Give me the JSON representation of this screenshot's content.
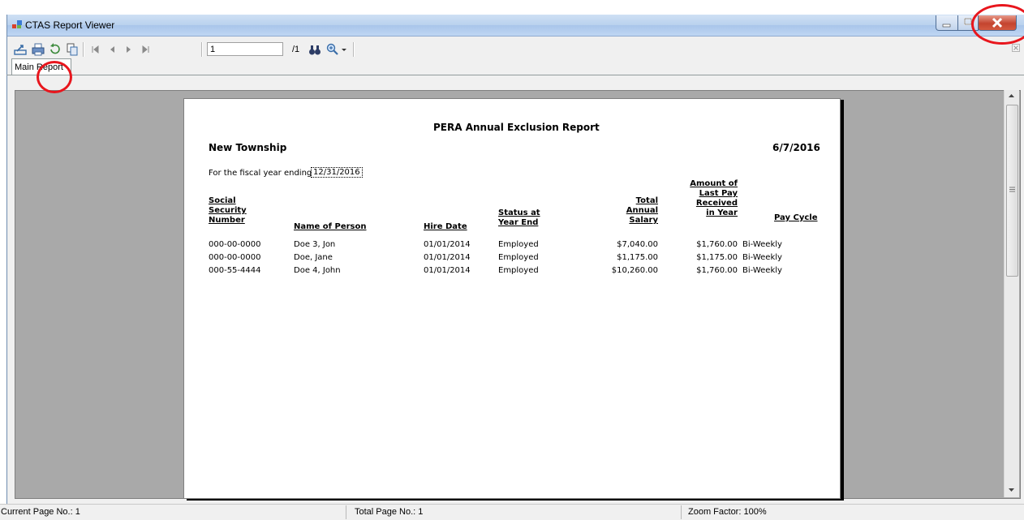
{
  "window": {
    "title": "CTAS Report Viewer"
  },
  "toolbar": {
    "page_value": "1",
    "page_total": "/1",
    "icons": [
      "export-icon",
      "print-icon",
      "refresh-icon",
      "copy-icon",
      "first-page-icon",
      "prev-page-icon",
      "next-page-icon",
      "last-page-icon",
      "binoculars-icon",
      "zoom-icon"
    ]
  },
  "tabs": [
    {
      "label": "Main Report"
    }
  ],
  "report": {
    "title": "PERA Annual Exclusion Report",
    "entity": "New Township",
    "date": "6/7/2016",
    "fiscal_label": "For the fiscal year ending",
    "fiscal_date": "12/31/2016",
    "columns": {
      "ssn": [
        "Social",
        "Security",
        "Number"
      ],
      "name": "Name of Person",
      "hire": "Hire Date",
      "status": [
        "Status at",
        "Year End"
      ],
      "salary": [
        "Total",
        "Annual",
        "Salary"
      ],
      "lastpay": [
        "Amount of",
        "Last Pay",
        "Received",
        "in Year"
      ],
      "cycle": "Pay Cycle"
    },
    "rows": [
      {
        "ssn": "000-00-0000",
        "name": "Doe 3, Jon",
        "hire": "01/01/2014",
        "status": "Employed",
        "salary": "$7,040.00",
        "lastpay": "$1,760.00",
        "cycle": "Bi-Weekly"
      },
      {
        "ssn": "000-00-0000",
        "name": "Doe, Jane",
        "hire": "01/01/2014",
        "status": "Employed",
        "salary": "$1,175.00",
        "lastpay": "$1,175.00",
        "cycle": "Bi-Weekly"
      },
      {
        "ssn": "000-55-4444",
        "name": "Doe 4, John",
        "hire": "01/01/2014",
        "status": "Employed",
        "salary": "$10,260.00",
        "lastpay": "$1,760.00",
        "cycle": "Bi-Weekly"
      }
    ]
  },
  "status": {
    "current_page": "Current Page No.: 1",
    "total_page": "Total Page No.: 1",
    "zoom": "Zoom Factor: 100%"
  },
  "colors": {
    "annotation_circle": "#e8161d",
    "close_button": "#c4442f"
  }
}
